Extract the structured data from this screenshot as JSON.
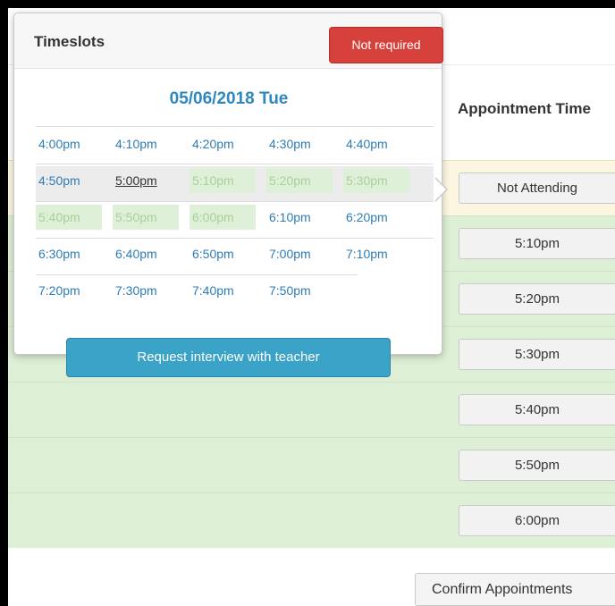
{
  "popover": {
    "title": "Timeslots",
    "not_required_label": "Not required",
    "date": "05/06/2018 Tue",
    "request_label": "Request interview with teacher",
    "slot_rows": [
      [
        {
          "time": "4:00pm",
          "state": "available"
        },
        {
          "time": "4:10pm",
          "state": "available"
        },
        {
          "time": "4:20pm",
          "state": "available"
        },
        {
          "time": "4:30pm",
          "state": "available"
        },
        {
          "time": "4:40pm",
          "state": "available"
        }
      ],
      [
        {
          "time": "4:50pm",
          "state": "available"
        },
        {
          "time": "5:00pm",
          "state": "selected"
        },
        {
          "time": "5:10pm",
          "state": "booked"
        },
        {
          "time": "5:20pm",
          "state": "booked"
        },
        {
          "time": "5:30pm",
          "state": "booked"
        }
      ],
      [
        {
          "time": "5:40pm",
          "state": "booked"
        },
        {
          "time": "5:50pm",
          "state": "booked"
        },
        {
          "time": "6:00pm",
          "state": "booked"
        },
        {
          "time": "6:10pm",
          "state": "available"
        },
        {
          "time": "6:20pm",
          "state": "available"
        }
      ],
      [
        {
          "time": "6:30pm",
          "state": "available"
        },
        {
          "time": "6:40pm",
          "state": "available"
        },
        {
          "time": "6:50pm",
          "state": "available"
        },
        {
          "time": "7:00pm",
          "state": "available"
        },
        {
          "time": "7:10pm",
          "state": "available"
        }
      ],
      [
        {
          "time": "7:20pm",
          "state": "available"
        },
        {
          "time": "7:30pm",
          "state": "available"
        },
        {
          "time": "7:40pm",
          "state": "available"
        },
        {
          "time": "7:50pm",
          "state": "available"
        }
      ]
    ]
  },
  "table": {
    "header": "Appointment Time",
    "appointments": [
      "Not Attending",
      "5:10pm",
      "5:20pm",
      "5:30pm",
      "5:40pm",
      "5:50pm",
      "6:00pm"
    ],
    "confirm_label": "Confirm Appointments"
  },
  "colors": {
    "accent_blue": "#2e87bd",
    "danger_red": "#d6413c",
    "request_blue": "#3aa3c7",
    "booked_green": "#dff0d8",
    "row_green": "#ddefd5"
  }
}
